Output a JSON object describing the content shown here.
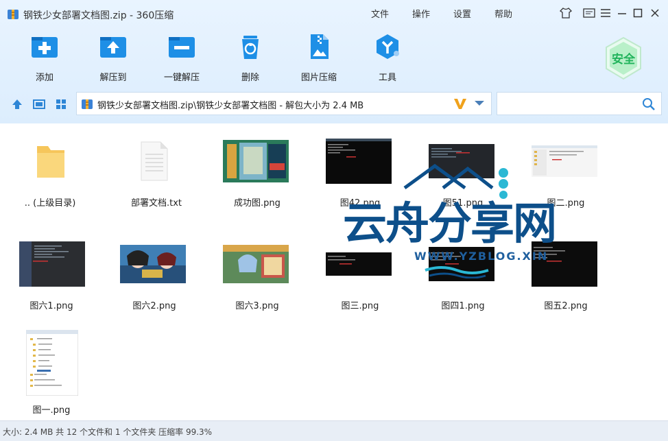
{
  "window": {
    "title": "钢铁少女部署文档图.zip - 360压缩",
    "menu": [
      "文件",
      "操作",
      "设置",
      "帮助"
    ]
  },
  "toolbar": {
    "items": [
      {
        "label": "添加",
        "icon": "add-icon"
      },
      {
        "label": "解压到",
        "icon": "extract-to-icon"
      },
      {
        "label": "一键解压",
        "icon": "one-click-extract-icon"
      },
      {
        "label": "删除",
        "icon": "delete-icon"
      },
      {
        "label": "图片压缩",
        "icon": "image-compress-icon"
      },
      {
        "label": "工具",
        "icon": "tools-icon"
      }
    ],
    "safe_badge": "安全"
  },
  "address": {
    "path": "钢铁少女部署文档图.zip\\钢铁少女部署文档图 - 解包大小为 2.4 MB",
    "search_placeholder": ""
  },
  "files": [
    {
      "name": ".. (上级目录)",
      "kind": "folder"
    },
    {
      "name": "部署文档.txt",
      "kind": "text"
    },
    {
      "name": "成功图.png",
      "kind": "game"
    },
    {
      "name": "图42.png",
      "kind": "terminal"
    },
    {
      "name": "图51.png",
      "kind": "ide"
    },
    {
      "name": "图二.png",
      "kind": "explorer"
    },
    {
      "name": "图六1.png",
      "kind": "ide"
    },
    {
      "name": "图六2.png",
      "kind": "anime"
    },
    {
      "name": "图六3.png",
      "kind": "anime2"
    },
    {
      "name": "图三.png",
      "kind": "terminal"
    },
    {
      "name": "图四1.png",
      "kind": "terminal2"
    },
    {
      "name": "图五2.png",
      "kind": "terminal"
    },
    {
      "name": "图一.png",
      "kind": "tree"
    }
  ],
  "status": {
    "text": "大小: 2.4 MB 共 12 个文件和 1 个文件夹 压缩率 99.3%"
  },
  "watermark": {
    "main": "云舟分享网",
    "sub": "WWW.YZBLOG.XIN"
  },
  "colors": {
    "accent": "#1a8fe0",
    "toolbar_bg": "#e4f1fd",
    "watermark_dark": "#0d4f8a",
    "watermark_teal": "#2bb8d4"
  }
}
